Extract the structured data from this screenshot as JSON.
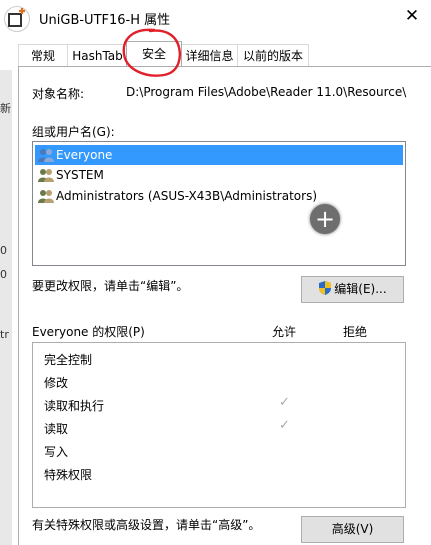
{
  "window": {
    "title": "UniGB-UTF16-H 属性",
    "close_label": "✕"
  },
  "tabs": [
    {
      "label": "常规"
    },
    {
      "label": "HashTab"
    },
    {
      "label": "安全"
    },
    {
      "label": "详细信息"
    },
    {
      "label": "以前的版本"
    }
  ],
  "active_tab": "安全",
  "background_fragments": [
    "新",
    "0",
    "0",
    "tr"
  ],
  "security": {
    "object_name_label": "对象名称:",
    "object_name_value": "D:\\Program Files\\Adobe\\Reader 11.0\\Resource\\",
    "groups_label": "组或用户名(G):",
    "users": [
      {
        "name": "Everyone",
        "selected": true
      },
      {
        "name": "SYSTEM",
        "selected": false
      },
      {
        "name": "Administrators (ASUS-X43B\\Administrators)",
        "selected": false
      }
    ],
    "change_perm_text": "要更改权限，请单击“编辑”。",
    "edit_button": "编辑(E)...",
    "perms_title": "Everyone 的权限(P)",
    "allow_header": "允许",
    "deny_header": "拒绝",
    "permissions": [
      {
        "name": "完全控制",
        "allow": false,
        "deny": false
      },
      {
        "name": "修改",
        "allow": false,
        "deny": false
      },
      {
        "name": "读取和执行",
        "allow": true,
        "deny": false
      },
      {
        "name": "读取",
        "allow": true,
        "deny": false
      },
      {
        "name": "写入",
        "allow": false,
        "deny": false
      },
      {
        "name": "特殊权限",
        "allow": false,
        "deny": false
      }
    ],
    "advanced_text": "有关特殊权限或高级设置，请单击“高级”。",
    "advanced_button": "高级(V)",
    "check_glyph": "✓"
  },
  "colors": {
    "selection": "#3399ff",
    "annotation_circle": "#e0202a"
  }
}
